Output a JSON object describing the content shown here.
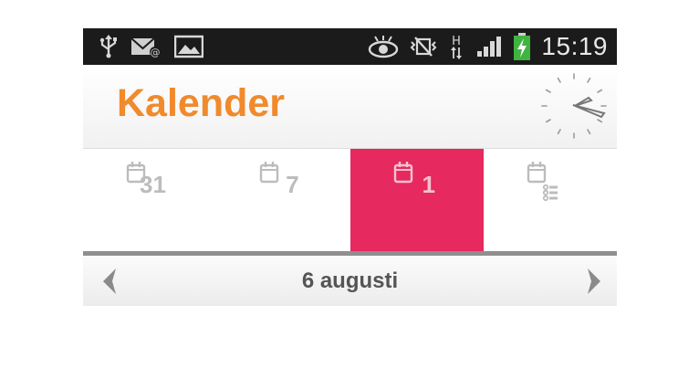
{
  "status_bar": {
    "time": "15:19",
    "icons_left": [
      "usb-icon",
      "email-notification-icon",
      "image-icon"
    ],
    "icons_right": [
      "eye-icon",
      "vibrate-icon",
      "network-h-icon",
      "signal-icon",
      "battery-charging-icon"
    ],
    "network_type": "H"
  },
  "header": {
    "title": "Kalender",
    "title_color": "#f08a2c"
  },
  "tabs": [
    {
      "id": "month",
      "icon": "calendar-month-icon",
      "label": "31",
      "active": false
    },
    {
      "id": "week",
      "icon": "calendar-week-icon",
      "label": "7",
      "active": false
    },
    {
      "id": "day",
      "icon": "calendar-day-icon",
      "label": "1",
      "active": true
    },
    {
      "id": "list",
      "icon": "calendar-list-icon",
      "label": "",
      "active": false
    }
  ],
  "colors": {
    "active_tab": "#e6295e",
    "accent": "#f08a2c",
    "statusbar": "#1b1b1b"
  },
  "date_nav": {
    "current_date": "6 augusti",
    "prev_icon": "chevron-left-icon",
    "next_icon": "chevron-right-icon"
  }
}
